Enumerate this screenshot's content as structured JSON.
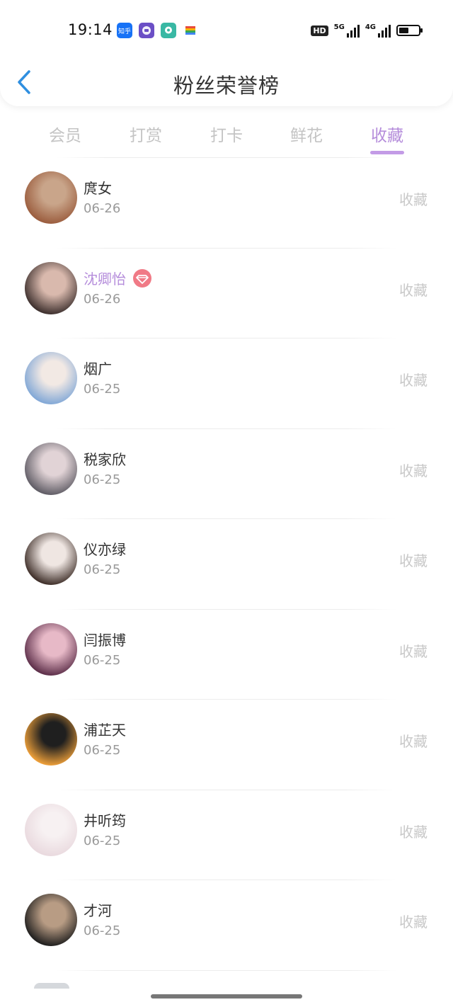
{
  "status_bar": {
    "time": "19:14",
    "apps": [
      {
        "icon": "zhihu-app-icon",
        "label": "知乎",
        "color": "#1772f6"
      },
      {
        "icon": "chat-bubble-app-icon",
        "label": "",
        "color": "#6b4fc6"
      },
      {
        "icon": "message-app-icon",
        "label": "",
        "color": "#39b8a4"
      },
      {
        "icon": "wallet-app-icon",
        "label": "",
        "color": "#f4b400"
      }
    ],
    "hd": "HD",
    "net1": "5G",
    "net2": "4G",
    "battery_level": 0.5
  },
  "header": {
    "title": "粉丝荣誉榜",
    "back_icon": "chevron-left-icon"
  },
  "tabs": [
    {
      "label": "会员",
      "active": false
    },
    {
      "label": "打赏",
      "active": false
    },
    {
      "label": "打卡",
      "active": false
    },
    {
      "label": "鲜花",
      "active": false
    },
    {
      "label": "收藏",
      "active": true
    }
  ],
  "list": [
    {
      "name": "庹女",
      "date": "06-26",
      "action": "收藏",
      "vip": false,
      "avatar_colors": [
        "#9a5b3c",
        "#c9a58a"
      ]
    },
    {
      "name": "沈卿怡",
      "date": "06-26",
      "action": "收藏",
      "vip": true,
      "avatar_colors": [
        "#3a2d2b",
        "#d9b9ad"
      ]
    },
    {
      "name": "烟广",
      "date": "06-25",
      "action": "收藏",
      "vip": false,
      "avatar_colors": [
        "#7fa6d6",
        "#f2e9e4"
      ]
    },
    {
      "name": "税家欣",
      "date": "06-25",
      "action": "收藏",
      "vip": false,
      "avatar_colors": [
        "#5d5a63",
        "#e1d3d6"
      ]
    },
    {
      "name": "仪亦绿",
      "date": "06-25",
      "action": "收藏",
      "vip": false,
      "avatar_colors": [
        "#3b2b25",
        "#efe6e2"
      ]
    },
    {
      "name": "闫振博",
      "date": "06-25",
      "action": "收藏",
      "vip": false,
      "avatar_colors": [
        "#5a2c47",
        "#e7b9c7"
      ]
    },
    {
      "name": "浦芷天",
      "date": "06-25",
      "action": "收藏",
      "vip": false,
      "avatar_colors": [
        "#f2a23a",
        "#1f1f1f"
      ]
    },
    {
      "name": "井听筠",
      "date": "06-25",
      "action": "收藏",
      "vip": false,
      "avatar_colors": [
        "#e9d9de",
        "#f7f1f2"
      ]
    },
    {
      "name": "才河",
      "date": "06-25",
      "action": "收藏",
      "vip": false,
      "avatar_colors": [
        "#1c1c1c",
        "#b89c84"
      ]
    }
  ]
}
